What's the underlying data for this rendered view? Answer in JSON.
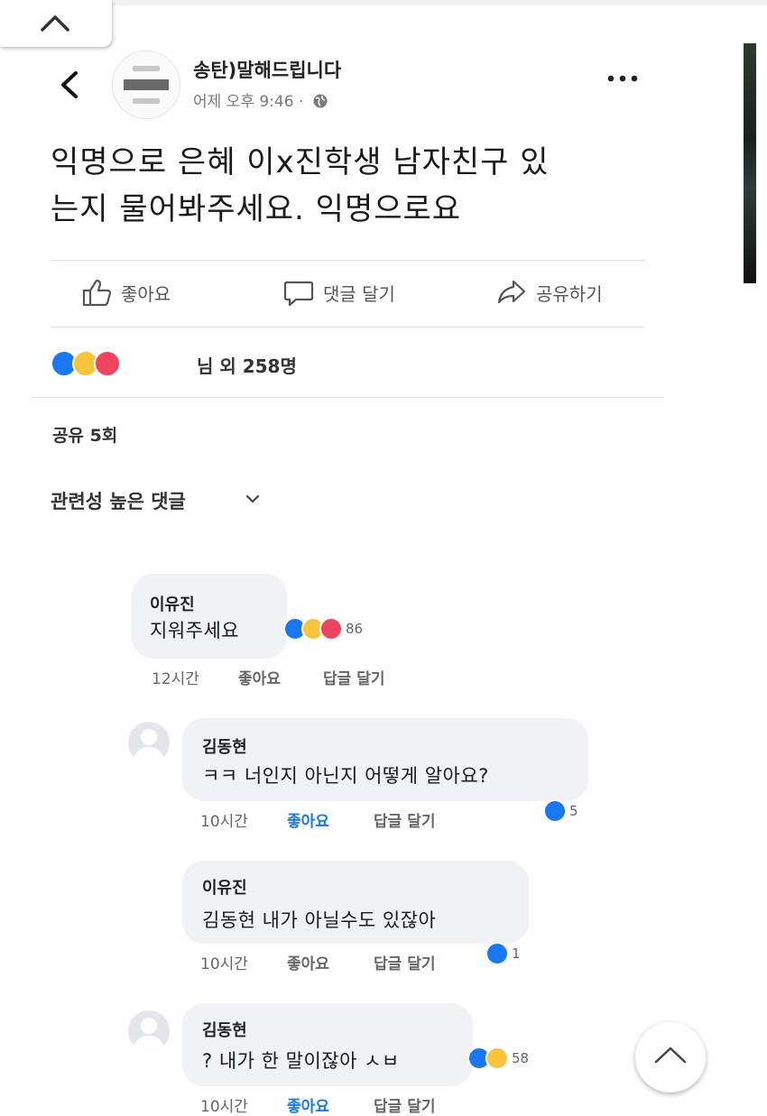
{
  "post": {
    "page_name": "송탄)말해드립니다",
    "time": "어제 오후 9:46 ·",
    "text_line1": "익명으로 은혜 이x진학생 남자친구 있",
    "text_line2": "는지 물어봐주세요. 익명으로요"
  },
  "actions": {
    "like": "좋아요",
    "comment": "댓글 달기",
    "share": "공유하기"
  },
  "reactions": {
    "count_text": "님 외 258명",
    "types": [
      "like",
      "haha",
      "love"
    ]
  },
  "shares": "공유 5회",
  "comments_sort": "관련성 높은 댓글",
  "comments": [
    {
      "author": "이유진",
      "text": "지워주세요",
      "time": "12시간",
      "like_label": "좋아요",
      "reply_label": "답글 달기",
      "reaction_count": "86"
    },
    {
      "author": "김동현",
      "text": "ㅋㅋ 너인지 아닌지 어떻게 알아요?",
      "time": "10시간",
      "like_label": "좋아요",
      "reply_label": "답글 달기",
      "reaction_count": "5"
    },
    {
      "author": "이유진",
      "text": "김동현  내가 아닐수도 있잖아",
      "time": "10시간",
      "like_label": "좋아요",
      "reply_label": "답글 달기",
      "reaction_count": "1"
    },
    {
      "author": "김동현",
      "text": "? 내가 한 말이잖아 ㅅㅂ",
      "time": "10시간",
      "like_label": "좋아요",
      "reply_label": "답글 달기",
      "reaction_count": "58"
    }
  ],
  "colors": {
    "like_blue": "#1877f2",
    "haha_yellow": "#f7c53a",
    "love_red": "#f0435f",
    "bubble_bg": "#f0f2f5"
  }
}
